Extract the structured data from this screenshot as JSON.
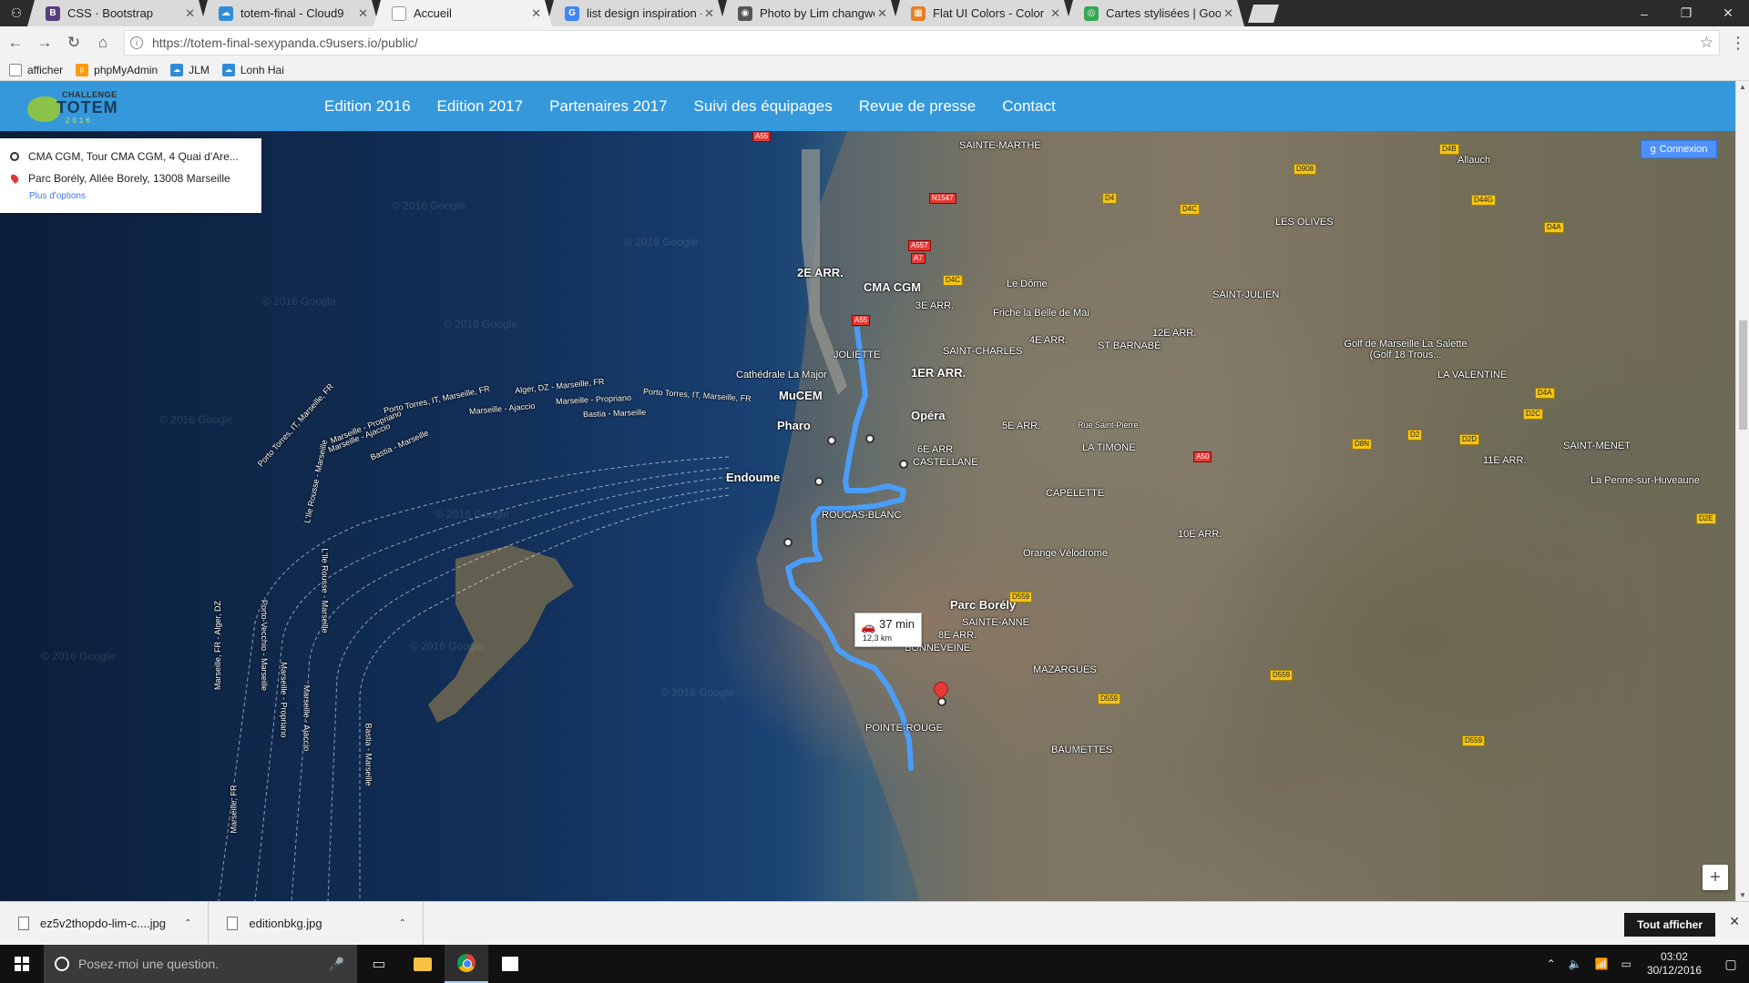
{
  "browser": {
    "tabs": [
      {
        "label": "CSS · Bootstrap",
        "icon": "bootstrap-icon",
        "color": "#563d7c",
        "glyph": "B"
      },
      {
        "label": "totem-final - Cloud9",
        "icon": "cloud9-icon",
        "color": "#2f8dd8",
        "glyph": "☁"
      },
      {
        "label": "Accueil",
        "icon": "page-icon",
        "color": "#9e9e9e",
        "glyph": ""
      },
      {
        "label": "list design inspiration - R",
        "icon": "google-icon",
        "color": "#4285f4",
        "glyph": "G"
      },
      {
        "label": "Photo by Lim changwon",
        "icon": "camera-icon",
        "color": "#555555",
        "glyph": "◉"
      },
      {
        "label": "Flat UI Colors - Color Pal",
        "icon": "palette-icon",
        "color": "#e67e22",
        "glyph": "▦"
      },
      {
        "label": "Cartes stylisées | Googl",
        "icon": "maps-icon",
        "color": "#34a853",
        "glyph": "◎"
      }
    ],
    "active_tab": 2,
    "url": "https://totem-final-sexypanda.c9users.io/public/",
    "bookmarks": [
      {
        "label": "afficher",
        "icon": "page-icon",
        "color": "#888888"
      },
      {
        "label": "phpMyAdmin",
        "icon": "phpmyadmin-icon",
        "color": "#f89c0e"
      },
      {
        "label": "JLM",
        "icon": "cloud9-icon",
        "color": "#2f8dd8"
      },
      {
        "label": "Lonh Hai",
        "icon": "cloud9-icon",
        "color": "#2f8dd8"
      }
    ]
  },
  "site": {
    "logo": {
      "line1": "CHALLENGE",
      "line2": "TOTEM",
      "line3": "2016"
    },
    "nav": [
      "Edition 2016",
      "Edition 2017",
      "Partenaires 2017",
      "Suivi des équipages",
      "Revue de presse",
      "Contact"
    ],
    "accent": "#3498db"
  },
  "map": {
    "origin": "CMA CGM, Tour CMA CGM, 4 Quai d'Are...",
    "destination": "Parc Borély, Allée Borely, 13008 Marseille",
    "more_options": "Plus d'options",
    "connexion": "Connexion",
    "duration": "37 min",
    "distance": "12,3 km",
    "watermark": "© 2016 Google",
    "places": [
      "SAINTE-MARTHE",
      "Allauch",
      "LES OLIVES",
      "SAINT-JULIEN",
      "2E ARR.",
      "CMA CGM",
      "Le Dôme",
      "Friche la Belle de Mai",
      "3E ARR.",
      "4E ARR.",
      "12E ARR.",
      "ST BARNABÉ",
      "JOLIETTE",
      "SAINT-CHARLES",
      "1ER ARR.",
      "Cathédrale La Major",
      "MuCEM",
      "Opéra",
      "Pharo",
      "5E ARR.",
      "LA TIMONE",
      "LA VALENTINE",
      "Golf de Marseille La Salette (Golf 18 Trous...",
      "Endoume",
      "6E ARR.",
      "CASTELLANE",
      "SAINT-MENET",
      "11E ARR.",
      "La Penne-sur-Huveaune",
      "CAPELETTE",
      "ROUCAS-BLANC",
      "10E ARR.",
      "Orange Vélodrome",
      "Parc Borély",
      "SAINTE-ANNE",
      "8E ARR.",
      "BONNEVEINE",
      "MAZARGUES",
      "POINTE-ROUGE",
      "BAUMETTES",
      "Rue Saint-Pierre"
    ],
    "ferries": [
      "Alger, DZ - Marseille, FR",
      "Porto Torres, IT, Marseille, FR",
      "Marseille - Propriano",
      "Marseille - Ajaccio",
      "Bastia - Marseille",
      "Porto Torres, IT, Marseille, FR",
      "Marseille - Propriano",
      "Marseille - Ajaccio",
      "Bastia - Marseille",
      "L'Ile Rousse - Marseille",
      "Porto Torres, IT, Marseille, FR",
      "Marseille, FR - Alger, DZ",
      "Porto-Vecchio - Marseille",
      "Marseille - Propriano",
      "Marseille - Ajaccio",
      "L'Ile Rousse - Marseille",
      "Bastia - Marseille",
      "Marseille, FR"
    ],
    "roads": [
      "A55",
      "D4B",
      "D908",
      "N1547",
      "D4",
      "D4C",
      "D44G",
      "D4A",
      "A557",
      "A7",
      "D4C",
      "A55",
      "D8N",
      "D2",
      "D2D",
      "A50",
      "D4A",
      "D2C",
      "D2E",
      "D559",
      "D559",
      "D559",
      "D559"
    ]
  },
  "downloads": {
    "items": [
      "ez5v2thopdo-lim-c....jpg",
      "editionbkg.jpg"
    ],
    "show_all": "Tout afficher"
  },
  "taskbar": {
    "search_placeholder": "Posez-moi une question.",
    "time": "03:02",
    "date": "30/12/2016"
  }
}
